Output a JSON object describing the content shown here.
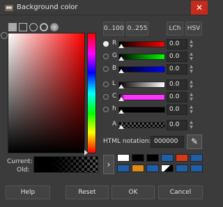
{
  "window": {
    "title": "Background color",
    "close_glyph": "✕"
  },
  "modes": {
    "range1": "0..100",
    "range2": "0..255",
    "lch": "LCh",
    "hsv": "HSV"
  },
  "channels": [
    {
      "label": "R",
      "value": "0.0",
      "selected": true,
      "track": "linear-gradient(to right,#000,#ff0000)"
    },
    {
      "label": "G",
      "value": "0.0",
      "selected": false,
      "track": "linear-gradient(to right,#000,#00ff00)"
    },
    {
      "label": "B",
      "value": "0.0",
      "selected": false,
      "track": "linear-gradient(to right,#000,#0000ff)"
    },
    {
      "label": "L",
      "value": "0.0",
      "selected": false,
      "track": "linear-gradient(to right,#000,#fff)"
    },
    {
      "label": "C",
      "value": "0.0",
      "selected": false,
      "track": "linear-gradient(to right,#000,#ff33ff)"
    },
    {
      "label": "h",
      "value": "0.0",
      "selected": false,
      "track": "linear-gradient(to right,#000,#000)"
    },
    {
      "label": "A",
      "value": "0.0",
      "selected": false,
      "track": "linear-gradient(to right,#555,#000)"
    }
  ],
  "html": {
    "label": "HTML notation:",
    "value": "000000"
  },
  "current_label": "Current:",
  "old_label": "Old:",
  "history": [
    "#ffffff",
    "#000000",
    "#000000",
    "#1f5fa8",
    "#d63a1a",
    "#d0d0d0",
    "#1f5fa8",
    "#e08a1a",
    "#1f5fa8",
    "#e8e8e8",
    "#1f5fa8",
    "#1f5fa8"
  ],
  "buttons": {
    "help": "Help",
    "reset": "Reset",
    "ok": "OK",
    "cancel": "Cancel"
  }
}
